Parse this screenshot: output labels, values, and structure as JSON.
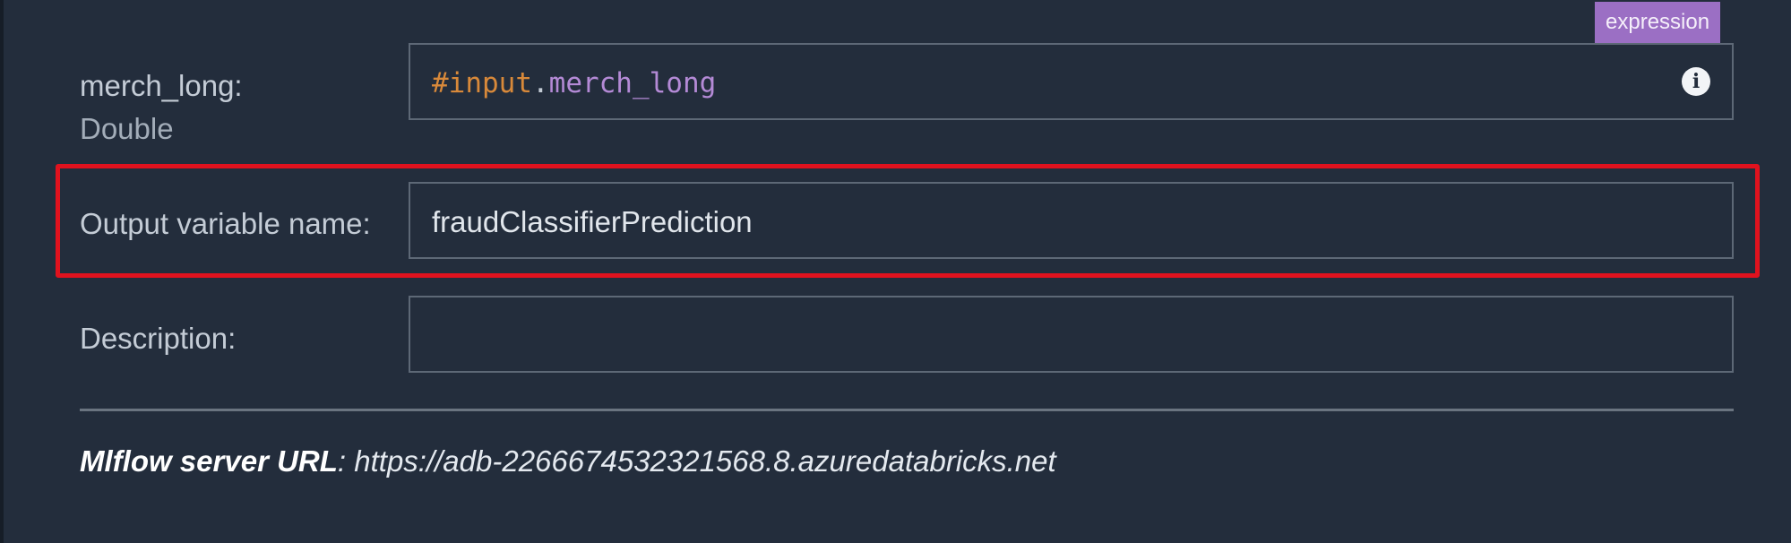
{
  "merch_long": {
    "label": "merch_long:",
    "type": "Double",
    "badge": "expression",
    "expression_hash": "#input",
    "expression_dot": ".",
    "expression_property": "merch_long",
    "info_icon": "info-icon"
  },
  "output_variable": {
    "label": "Output variable name:",
    "value": "fraudClassifierPrediction"
  },
  "description": {
    "label": "Description:",
    "value": ""
  },
  "footer": {
    "label": "Mlflow server URL",
    "separator": ": ",
    "url": "https://adb-2266674532321568.8.azuredatabricks.net"
  },
  "colors": {
    "background": "#232d3c",
    "badge": "#9b6fc4",
    "highlight": "#e0121e"
  }
}
